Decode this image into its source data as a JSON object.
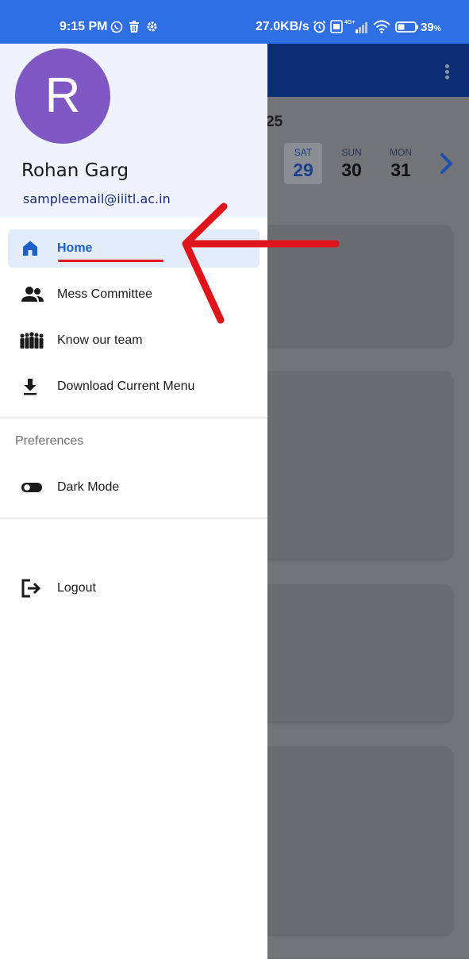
{
  "status_bar": {
    "time": "9:15 PM",
    "net_speed": "27.0KB/s",
    "battery": "39",
    "battery_unit": "%",
    "icons": [
      "whatsapp-icon",
      "trash-icon",
      "settings-icon",
      "alarm-icon",
      "volte-icon",
      "signal-icon",
      "wifi-icon",
      "battery-icon"
    ]
  },
  "background_app": {
    "year_fragment": "25",
    "days": [
      {
        "name": "SAT",
        "date": "29",
        "selected": true
      },
      {
        "name": "SUN",
        "date": "30",
        "selected": false
      },
      {
        "name": "MON",
        "date": "31",
        "selected": false
      }
    ]
  },
  "drawer": {
    "avatar_letter": "R",
    "avatar_color": "#7f58c4",
    "user_name": "Rohan Garg",
    "user_email": "sampleemail@iiitl.ac.in",
    "nav": [
      {
        "label": "Home",
        "icon": "home-icon",
        "active": true
      },
      {
        "label": "Mess Committee",
        "icon": "people-icon",
        "active": false
      },
      {
        "label": "Know our team",
        "icon": "team-icon",
        "active": false
      },
      {
        "label": "Download Current Menu",
        "icon": "download-icon",
        "active": false
      }
    ],
    "preferences_title": "Preferences",
    "dark_mode_label": "Dark Mode",
    "logout_label": "Logout"
  },
  "colors": {
    "status_bar": "#2f6fe4",
    "app_bar": "#0a2d74",
    "accent": "#1c5fc8",
    "annotation": "#e0141b"
  }
}
